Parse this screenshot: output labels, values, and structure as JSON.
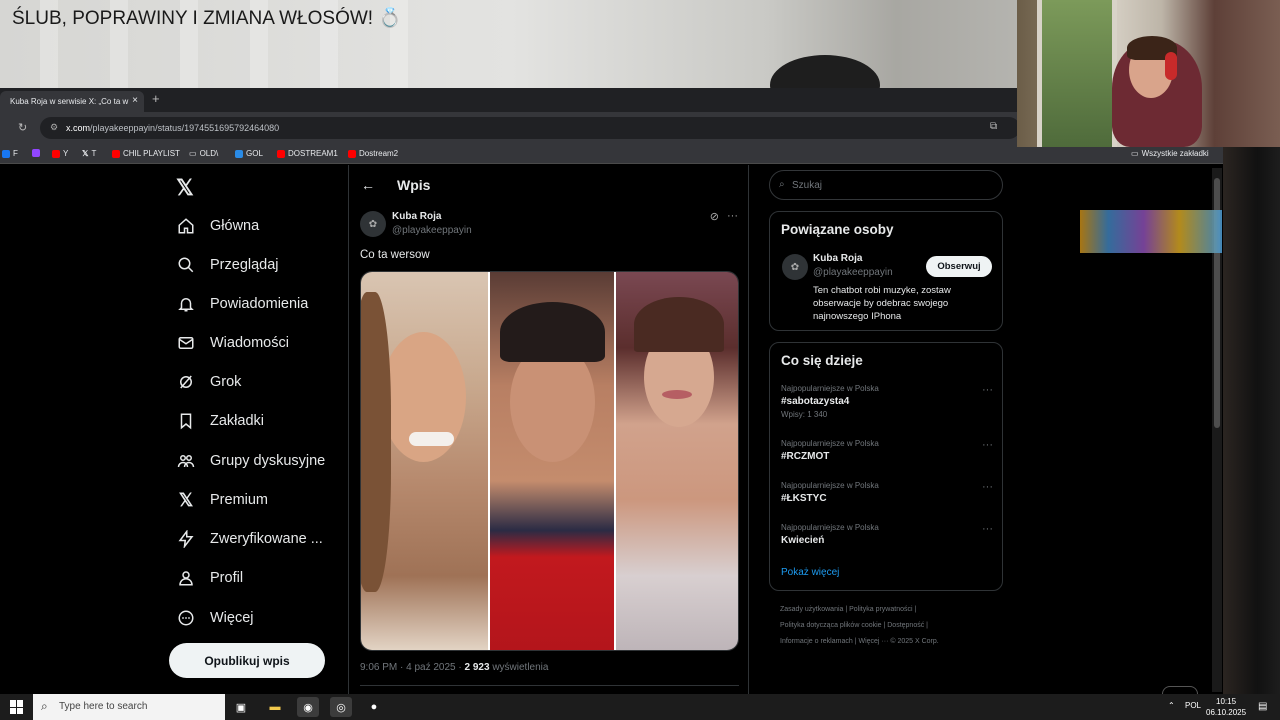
{
  "stream": {
    "title": "ŚLUB, POPRAWINY I ZMIANA WŁOSÓW! 💍"
  },
  "browser": {
    "tab_title": "Kuba Roja w serwisie X: „Co ta w",
    "tab_close": "×",
    "new_tab": "+",
    "url_host": "x.com",
    "url_path": "/playakeeppayin/status/1974551695792464080",
    "bookmarks": [
      "F",
      "Y",
      "T",
      "CHIL PLAYLIST",
      "OLD\\",
      "GOL",
      "DOSTREAM1",
      "Dostream2"
    ],
    "all_bookmarks": "Wszystkie zakładki"
  },
  "nav": {
    "logo": "𝕏",
    "items": [
      "Główna",
      "Przeglądaj",
      "Powiadomienia",
      "Wiadomości",
      "Grok",
      "Zakładki",
      "Grupy dyskusyjne",
      "Premium",
      "Zweryfikowane ...",
      "Profil",
      "Więcej"
    ],
    "post_button": "Opublikuj wpis"
  },
  "post": {
    "header": "Wpis",
    "author_name": "Kuba Roja",
    "author_handle": "@playakeeppayin",
    "text": "Co ta wersow",
    "time": "9:06 PM · 4 paź 2025 · ",
    "views_count": "2 923",
    "views_label": " wyświetlenia"
  },
  "search": {
    "placeholder": "Szukaj"
  },
  "related": {
    "title": "Powiązane osoby",
    "name": "Kuba Roja",
    "handle": "@playakeeppayin",
    "follow": "Obserwuj",
    "bio": "Ten chatbot robi muzyke, zostaw obserwacje by odebrac swojego najnowszego IPhona"
  },
  "trends": {
    "title": "Co się dzieje",
    "items": [
      {
        "context": "Najpopularniejsze w Polska",
        "name": "#sabotazysta4",
        "count": "Wpisy: 1 340"
      },
      {
        "context": "Najpopularniejsze w Polska",
        "name": "#RCZMOT",
        "count": ""
      },
      {
        "context": "Najpopularniejsze w Polska",
        "name": "#ŁKSTYC",
        "count": ""
      },
      {
        "context": "Najpopularniejsze w Polska",
        "name": "Kwiecień",
        "count": ""
      }
    ],
    "more": "Pokaż więcej"
  },
  "footer": {
    "line1": "Zasady użytkowania  |  Polityka prywatności  |",
    "line2": "Polityka dotycząca plików cookie  |  Dostępność  |",
    "line3": "Informacje o reklamach  |  Więcej ···  © 2025 X Corp."
  },
  "taskbar": {
    "search_placeholder": "Type here to search",
    "language": "POL",
    "time": "10:15",
    "date": "06.10.2025"
  }
}
